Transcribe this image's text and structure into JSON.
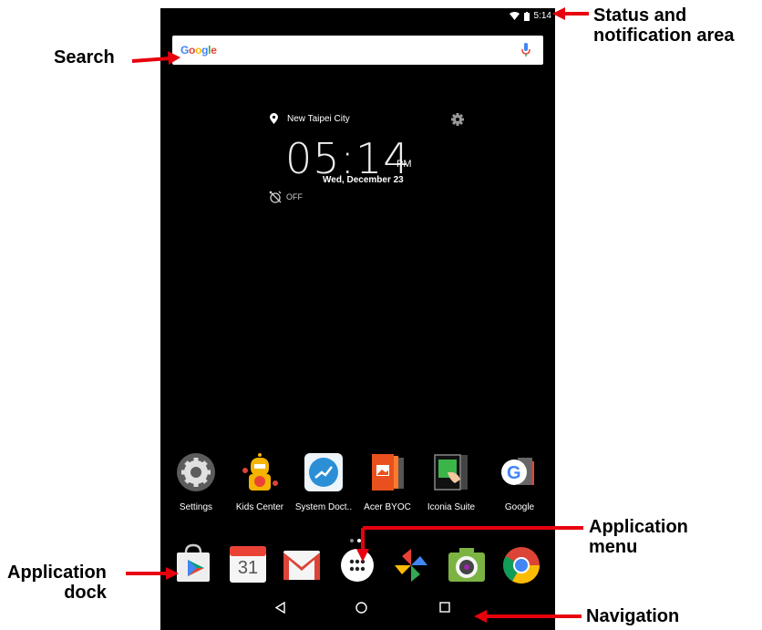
{
  "status": {
    "time": "5:14"
  },
  "search": {
    "logo": "Google",
    "mic_icon": "mic-icon"
  },
  "clock": {
    "city": "New Taipei City",
    "time": "05:14",
    "ampm": "PM",
    "date": "Wed, December 23",
    "alarm": "OFF"
  },
  "apps": [
    {
      "label": "Settings",
      "icon": "settings-icon"
    },
    {
      "label": "Kids Center",
      "icon": "kids-center-icon"
    },
    {
      "label": "System Doct..",
      "icon": "system-doctor-icon"
    },
    {
      "label": "Acer BYOC",
      "icon": "acer-byoc-icon"
    },
    {
      "label": "Iconia Suite",
      "icon": "iconia-suite-icon"
    },
    {
      "label": "Google",
      "icon": "google-folder-icon"
    }
  ],
  "dock": [
    {
      "icon": "play-store-icon"
    },
    {
      "icon": "calendar-icon",
      "text": "31"
    },
    {
      "icon": "gmail-icon"
    },
    {
      "icon": "app-menu-icon"
    },
    {
      "icon": "photos-icon"
    },
    {
      "icon": "camera-icon"
    },
    {
      "icon": "chrome-icon"
    }
  ],
  "callouts": {
    "status": "Status and\nnotification area",
    "search": "Search",
    "app_dock": "Application\ndock",
    "app_menu": "Application\nmenu",
    "navigation": "Navigation"
  },
  "colors": {
    "callout_red": "#e8000d",
    "screen_bg": "#000000"
  }
}
